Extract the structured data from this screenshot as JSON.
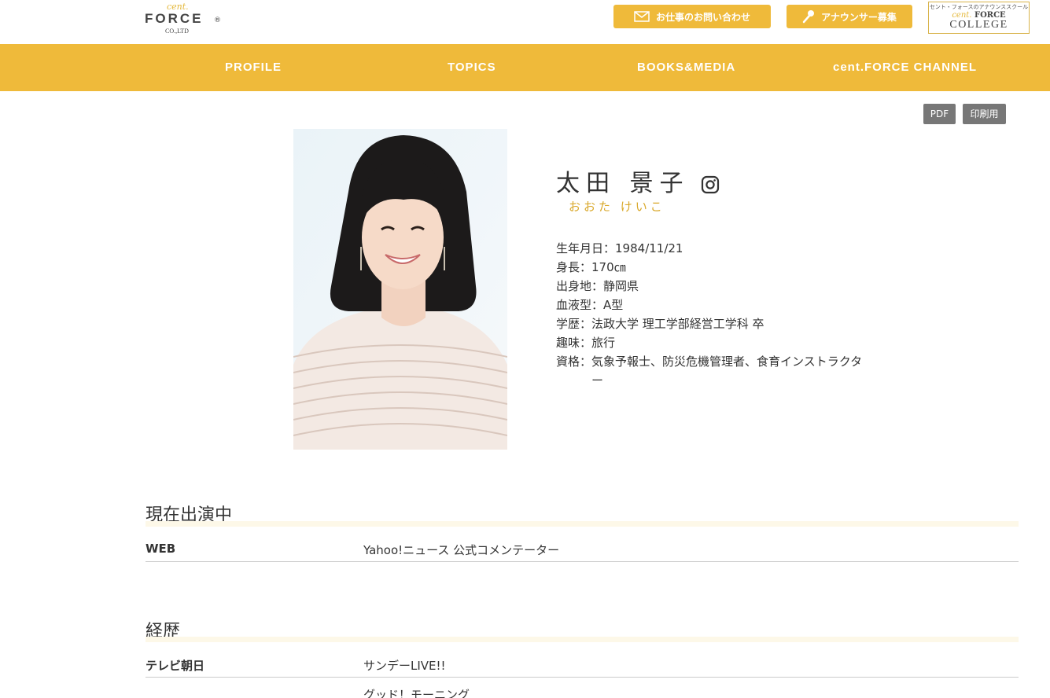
{
  "header": {
    "logo": {
      "cent": "cent.",
      "force": "FORCE",
      "reg": "®",
      "coltd": "CO.,LTD"
    },
    "contact_label": "お仕事のお問い合わせ",
    "recruit_label": "アナウンサー募集",
    "college": {
      "top": "セント・フォースのアナウンススクール",
      "cent": "cent.",
      "force": "FORCE",
      "bottom": "COLLEGE"
    }
  },
  "nav": {
    "items": [
      "PROFILE",
      "TOPICS",
      "BOOKS&MEDIA",
      "cent.FORCE CHANNEL"
    ]
  },
  "tools": {
    "pdf": "PDF",
    "print": "印刷用"
  },
  "profile": {
    "name": "太田 景子",
    "kana": "おおた けいこ",
    "rows": [
      {
        "label": "生年月日：",
        "value": "1984/11/21"
      },
      {
        "label": "身長：",
        "value": "170㎝"
      },
      {
        "label": "出身地：",
        "value": "静岡県"
      },
      {
        "label": "血液型：",
        "value": "A型"
      },
      {
        "label": "学歴：",
        "value": "法政大学 理工学部経営工学科 卒"
      },
      {
        "label": "趣味：",
        "value": "旅行"
      },
      {
        "label": "資格：",
        "value": "気象予報士、防災危機管理者、食育インストラクター"
      }
    ]
  },
  "current": {
    "title": "現在出演中",
    "rows": [
      {
        "key": "WEB",
        "value": "Yahoo!ニュース 公式コメンテーター"
      }
    ]
  },
  "career": {
    "title": "経歴",
    "rows": [
      {
        "key": "テレビ朝日",
        "value": "サンデーLIVE!!"
      },
      {
        "key": "",
        "value": "グッド！モーニング"
      }
    ]
  },
  "colors": {
    "accent": "#efba3a",
    "kana": "#d9a82a",
    "tool_button": "#777777"
  },
  "icons": [
    "mail-icon",
    "microphone-icon",
    "instagram-icon"
  ]
}
